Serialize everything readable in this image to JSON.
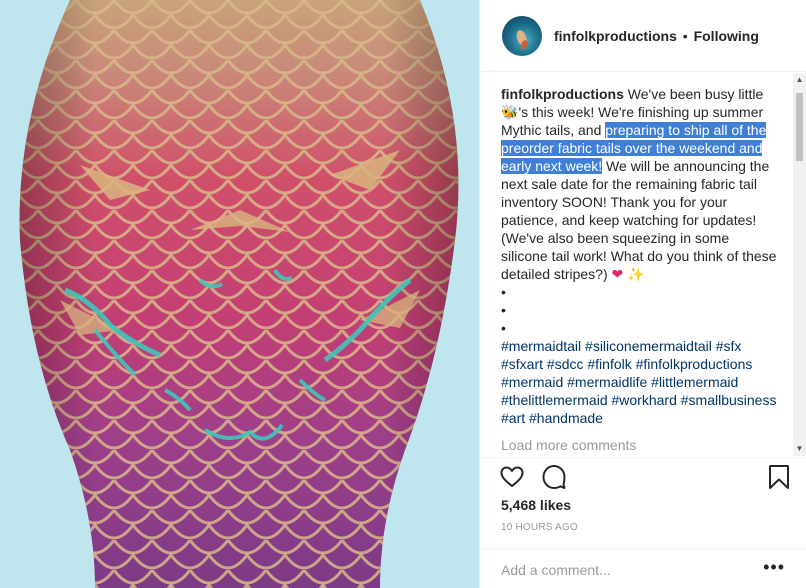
{
  "header": {
    "username": "finfolkproductions",
    "separator": "•",
    "follow_state": "Following"
  },
  "caption": {
    "username": "finfolkproductions",
    "part1": " We've been busy little ",
    "bee_emoji": "🐝",
    "part2": "'s this week! We're finishing up summer Mythic tails, and ",
    "highlighted": "preparing to ship all of the preorder fabric tails over the weekend and early next week!",
    "part3": " We will be announcing the next sale date for the remaining fabric tail inventory SOON! Thank you for your patience, and keep watching for updates! (We've also been squeezing in some silicone tail work! What do you think of these detailed stripes?) ",
    "heart_emoji": "❤",
    "sparkle_emoji": "✨",
    "bullets": [
      "•",
      "•",
      "•"
    ],
    "hashtags": "#mermaidtail #siliconemermaidtail #sfx #sfxart #sdcc #finfolk #finfolkproductions #mermaid #mermaidlife #littlemermaid #thelittlemermaid #workhard #smallbusiness #art #handmade"
  },
  "load_more": "Load more comments",
  "likes": "5,468 likes",
  "timestamp": "10 HOURS AGO",
  "comment": {
    "placeholder": "Add a comment...",
    "more": "•••"
  },
  "scrollbar": {
    "up": "▲",
    "down": "▼"
  },
  "icons": {
    "like": "heart-outline-icon",
    "comment": "speech-bubble-icon",
    "save": "bookmark-icon"
  },
  "colors": {
    "highlight": "#3f7fd8",
    "hashtag": "#003569",
    "muted": "#999999"
  }
}
